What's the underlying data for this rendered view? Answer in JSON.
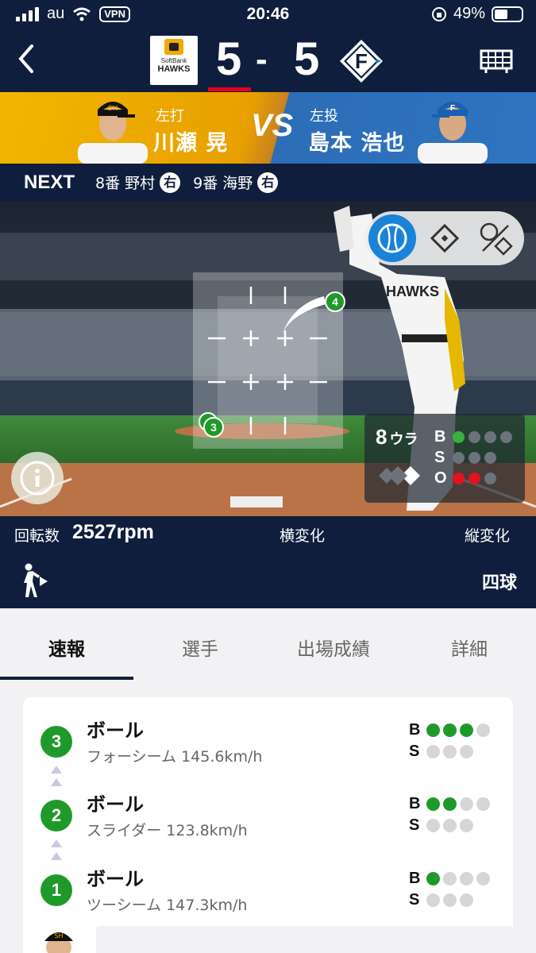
{
  "status_bar": {
    "carrier": "au",
    "vpn": "VPN",
    "time": "20:46",
    "battery": "49%"
  },
  "score": {
    "home_team": "SoftBank HAWKS",
    "home_logo_small": "SoftBank",
    "home_logo_big": "HAWKS",
    "home_score": "5",
    "separator": "-",
    "away_score": "5",
    "away_logo": "F"
  },
  "matchup": {
    "batter_role": "左打",
    "batter_name": "川瀬 晃",
    "vs": "VS",
    "pitcher_role": "左投",
    "pitcher_name": "島本 浩也"
  },
  "next": {
    "label": "NEXT",
    "batters": [
      {
        "order": "8番 野村",
        "hand": "右"
      },
      {
        "order": "9番 海野",
        "hand": "右"
      }
    ]
  },
  "field": {
    "pitch_markers": [
      "4",
      "3"
    ],
    "inning": "8",
    "inning_half": "ウラ",
    "count": {
      "balls": 1,
      "strikes": 0,
      "outs": 2
    },
    "labels": {
      "ball": "B",
      "strike": "S",
      "out": "O"
    }
  },
  "pitch_info": {
    "spin_label": "回転数",
    "spin_value": "2527rpm",
    "h_break_label": "横変化",
    "v_break_label": "縦変化",
    "result": "四球"
  },
  "tabs": [
    "速報",
    "選手",
    "出場成績",
    "詳細"
  ],
  "feed": [
    {
      "number": "3",
      "result": "ボール",
      "detail": "フォーシーム 145.6km/h",
      "balls": 3,
      "strikes": 0
    },
    {
      "number": "2",
      "result": "ボール",
      "detail": "スライダー 123.8km/h",
      "balls": 2,
      "strikes": 0
    },
    {
      "number": "1",
      "result": "ボール",
      "detail": "ツーシーム 147.3km/h",
      "balls": 1,
      "strikes": 0
    }
  ],
  "colors": {
    "navy": "#0f1e3c",
    "accent_red": "#e6001f",
    "ball_green": "#1f9a2a",
    "active_blue": "#1a82d8"
  },
  "icons": {
    "back": "chevron-left-icon",
    "scoreboard": "scoreboard-icon",
    "info": "info-icon",
    "walk": "batter-walk-icon",
    "view_pitch": "baseball-icon",
    "view_field": "diamond-icon",
    "view_both": "ball-and-diamond-icon"
  }
}
